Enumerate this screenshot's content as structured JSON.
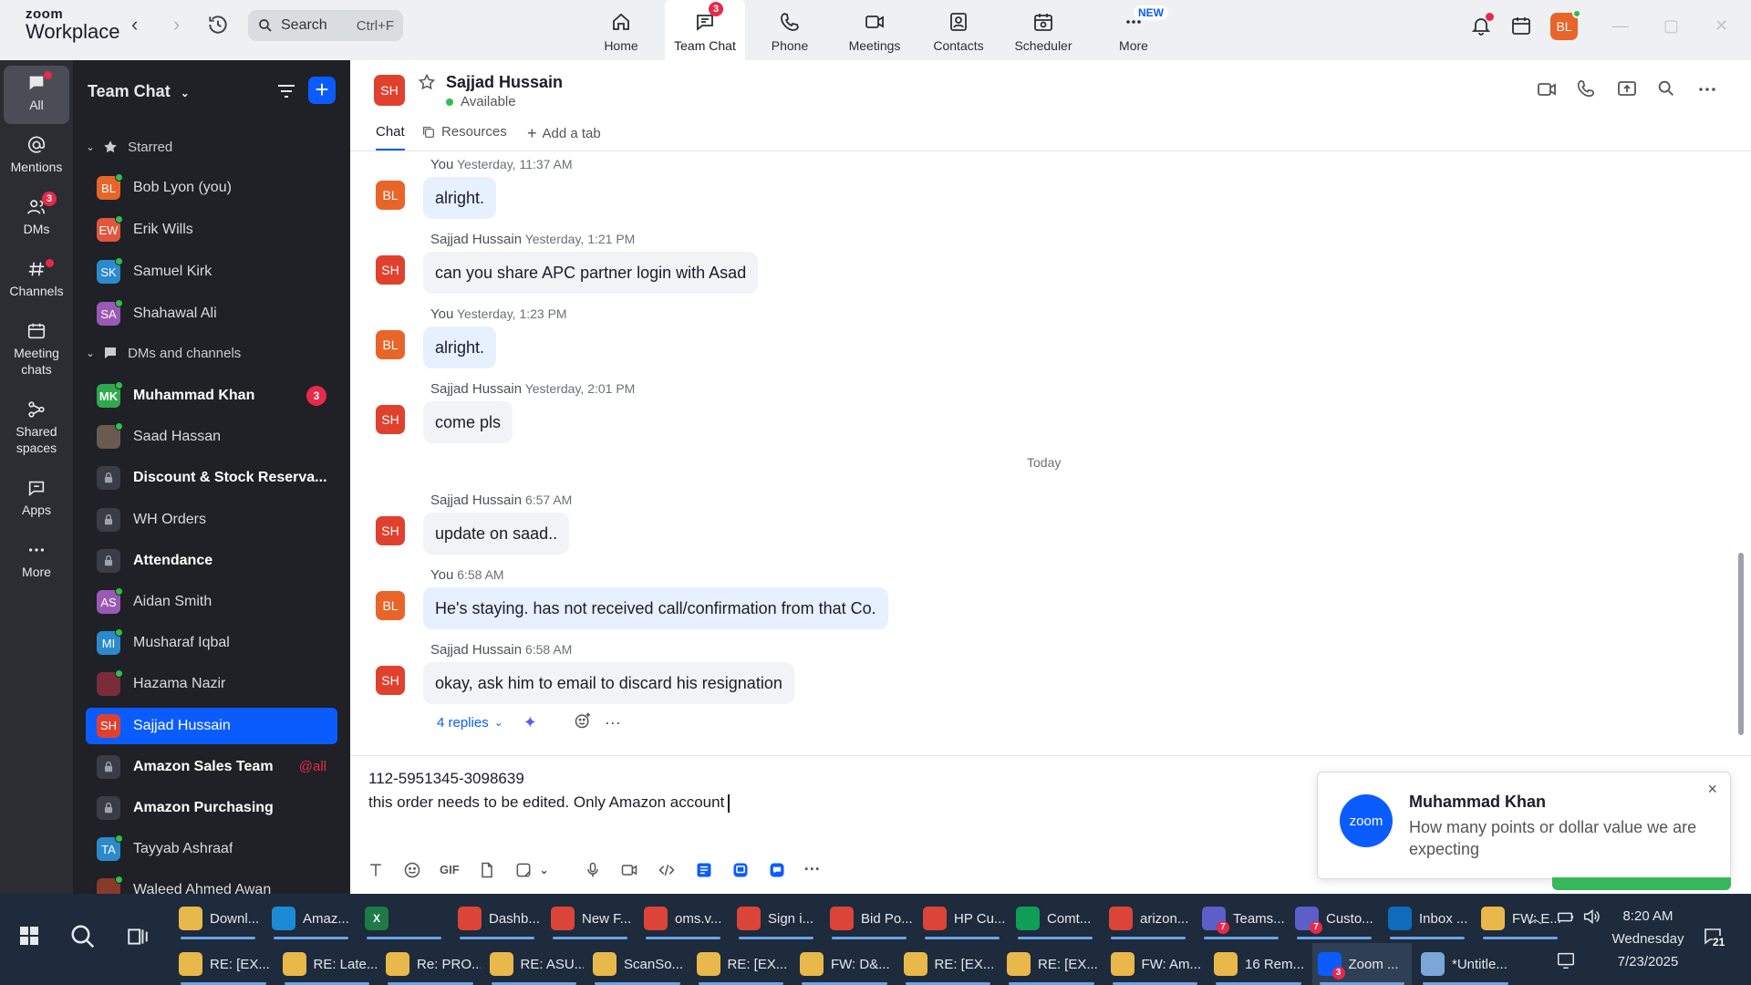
{
  "app": {
    "brand_top": "zoom",
    "brand_bottom": "Workplace",
    "search_label": "Search",
    "search_shortcut": "Ctrl+F"
  },
  "nav": {
    "tabs": [
      {
        "label": "Home",
        "icon": "home-icon"
      },
      {
        "label": "Team Chat",
        "icon": "chat-icon",
        "badge": "3",
        "active": true
      },
      {
        "label": "Phone",
        "icon": "phone-icon"
      },
      {
        "label": "Meetings",
        "icon": "video-icon"
      },
      {
        "label": "Contacts",
        "icon": "contacts-icon"
      },
      {
        "label": "Scheduler",
        "icon": "calendar-icon"
      },
      {
        "label": "More",
        "icon": "more-icon",
        "tag": "NEW"
      }
    ]
  },
  "profile": {
    "initials": "BL",
    "color": "#e8652a"
  },
  "rail": [
    {
      "label": "All"
    },
    {
      "label": "Mentions"
    },
    {
      "label": "DMs",
      "badge": "3"
    },
    {
      "label": "Channels"
    },
    {
      "label": "Meeting chats"
    },
    {
      "label": "Shared spaces"
    },
    {
      "label": "Apps"
    },
    {
      "label": "More"
    }
  ],
  "sidebar": {
    "title": "Team Chat",
    "starred_label": "Starred",
    "dms_label": "DMs and channels",
    "starred": [
      {
        "name": "Bob Lyon (you)",
        "initials": "BL",
        "color": "#e8652a"
      },
      {
        "name": "Erik Wills",
        "initials": "EW",
        "color": "#e0573e"
      },
      {
        "name": "Samuel Kirk",
        "initials": "SK",
        "color": "#2b8acb"
      },
      {
        "name": "Shahawal Ali",
        "initials": "SA",
        "color": "#9b59b6"
      }
    ],
    "items": [
      {
        "name": "Muhammad Khan",
        "initials": "MK",
        "color": "#2fa84f",
        "bold": true,
        "count": "3"
      },
      {
        "name": "Saad Hassan",
        "initials": "",
        "color": "#6a5a50"
      },
      {
        "name": "Discount & Stock Reserva...",
        "lock": true,
        "bold": true
      },
      {
        "name": "WH Orders",
        "lock": true
      },
      {
        "name": "Attendance",
        "lock": true,
        "bold": true
      },
      {
        "name": "Aidan Smith",
        "initials": "AS",
        "color": "#9b59b6"
      },
      {
        "name": "Musharaf Iqbal",
        "initials": "MI",
        "color": "#2b8acb"
      },
      {
        "name": "Hazama Nazir",
        "initials": "",
        "color": "#7a2c3a"
      },
      {
        "name": "Sajjad Hussain",
        "initials": "SH",
        "color": "#e0412e",
        "selected": true
      },
      {
        "name": "Amazon Sales Team",
        "lock": true,
        "bold": true,
        "mention": "@all"
      },
      {
        "name": "Amazon Purchasing",
        "lock": true,
        "bold": true
      },
      {
        "name": "Tayyab Ashraaf",
        "initials": "TA",
        "color": "#2b8acb"
      },
      {
        "name": "Waleed Ahmed Awan",
        "initials": "",
        "color": "#8a3a2a"
      }
    ]
  },
  "chat": {
    "contact_name": "Sajjad Hussain",
    "contact_initials": "SH",
    "status": "Available",
    "tabs": [
      "Chat",
      "Resources",
      "Add a tab"
    ],
    "today_label": "Today",
    "messages": [
      {
        "sender": "You",
        "time": "Yesterday, 11:37 AM",
        "text": "alright.",
        "initials": "BL",
        "mine": true
      },
      {
        "sender": "Sajjad Hussain",
        "time": "Yesterday, 1:21 PM",
        "text": "can you share APC partner login with Asad",
        "initials": "SH"
      },
      {
        "sender": "You",
        "time": "Yesterday, 1:23 PM",
        "text": "alright.",
        "initials": "BL",
        "mine": true
      },
      {
        "sender": "Sajjad Hussain",
        "time": "Yesterday, 2:01 PM",
        "text": "come pls",
        "initials": "SH"
      },
      {
        "sender": "Sajjad Hussain",
        "time": "6:57 AM",
        "text": "update on saad..",
        "initials": "SH"
      },
      {
        "sender": "You",
        "time": "6:58 AM",
        "text": "He's staying. has not received call/confirmation from that Co.",
        "initials": "BL",
        "mine": true
      },
      {
        "sender": "Sajjad Hussain",
        "time": "6:58 AM",
        "text": "okay, ask him to email to discard his resignation",
        "initials": "SH"
      }
    ],
    "replies_label": "4 replies"
  },
  "compose": {
    "line1": "112-5951345-3098639",
    "line2": "this order needs to be edited. Only Amazon account",
    "gif_label": "GIF"
  },
  "toast": {
    "logo": "zoom",
    "name": "Muhammad Khan",
    "body": "How many points or dollar value we are expecting",
    "close": "×"
  },
  "taskbar": {
    "row1": [
      {
        "label": "Downl...",
        "icon": "folder-icon",
        "color": "#e8b84a"
      },
      {
        "label": "Amaz...",
        "icon": "edge-icon",
        "color": "#1d8ad8"
      },
      {
        "label": "",
        "icon": "excel-icon",
        "color": "#1f7a45",
        "glyph": "X"
      },
      {
        "label": "Dashb...",
        "icon": "chrome-icon",
        "color": "#db4437"
      },
      {
        "label": "New F...",
        "icon": "chrome-icon",
        "color": "#db4437"
      },
      {
        "label": "oms.v...",
        "icon": "chrome-icon",
        "color": "#db4437"
      },
      {
        "label": "Sign i...",
        "icon": "chrome-icon",
        "color": "#db4437"
      },
      {
        "label": "Bid Po...",
        "icon": "chrome-icon",
        "color": "#db4437"
      },
      {
        "label": "HP Cu...",
        "icon": "chrome-icon",
        "color": "#db4437"
      },
      {
        "label": "Comt...",
        "icon": "chrome-icon",
        "color": "#0f9d58"
      },
      {
        "label": "arizon...",
        "icon": "chrome-icon",
        "color": "#db4437"
      },
      {
        "label": "Teams...",
        "icon": "teams-icon",
        "color": "#5b5fc7",
        "badge": "7"
      },
      {
        "label": "Custo...",
        "icon": "teams-icon",
        "color": "#5b5fc7",
        "badge": "7"
      },
      {
        "label": "Inbox ...",
        "icon": "outlook-icon",
        "color": "#0f6cbd"
      },
      {
        "label": "FW: E...",
        "icon": "mail-icon",
        "color": "#e8b84a"
      }
    ],
    "row2": [
      {
        "label": "RE: [EX...",
        "icon": "mail-icon",
        "color": "#e8b84a"
      },
      {
        "label": "RE: Late...",
        "icon": "mail-icon",
        "color": "#e8b84a"
      },
      {
        "label": "Re: PRO...",
        "icon": "mail-icon",
        "color": "#e8b84a"
      },
      {
        "label": "RE: ASU...",
        "icon": "mail-icon",
        "color": "#e8b84a"
      },
      {
        "label": "ScanSo...",
        "icon": "mail-icon",
        "color": "#e8b84a"
      },
      {
        "label": "RE: [EX...",
        "icon": "mail-icon",
        "color": "#e8b84a"
      },
      {
        "label": "FW: D&...",
        "icon": "mail-icon",
        "color": "#e8b84a"
      },
      {
        "label": "RE: [EX...",
        "icon": "mail-icon",
        "color": "#e8b84a"
      },
      {
        "label": "RE: [EX...",
        "icon": "mail-icon",
        "color": "#e8b84a"
      },
      {
        "label": "FW: Am...",
        "icon": "mail-icon",
        "color": "#e8b84a"
      },
      {
        "label": "16 Rem...",
        "icon": "bell-icon",
        "color": "#e8b84a"
      },
      {
        "label": "Zoom ...",
        "icon": "zoom-icon",
        "color": "#0b5cff",
        "badge": "3",
        "active": true
      },
      {
        "label": "*Untitle...",
        "icon": "notepad-icon",
        "color": "#7aa6d8"
      }
    ],
    "time": "8:20 AM",
    "day": "Wednesday",
    "date": "7/23/2025",
    "notif_count": "21"
  }
}
